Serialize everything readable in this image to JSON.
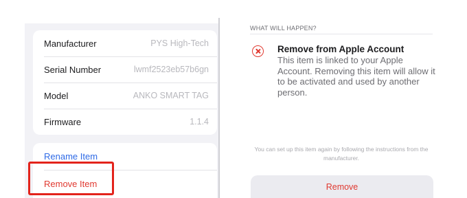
{
  "device_info": {
    "rows": [
      {
        "label": "Manufacturer",
        "value": "PYS High-Tech"
      },
      {
        "label": "Serial Number",
        "value": "lwmf2523eb57b6gn"
      },
      {
        "label": "Model",
        "value": "ANKO SMART TAG"
      },
      {
        "label": "Firmware",
        "value": "1.1.4"
      }
    ]
  },
  "actions": {
    "rename_label": "Rename Item",
    "remove_label": "Remove Item"
  },
  "confirm": {
    "section_header": "WHAT WILL HAPPEN?",
    "title": "Remove from Apple Account",
    "description": "This item is linked to your Apple Account. Removing this item will allow it to be activated and used by another person.",
    "footer_note": "You can set up this item again by following the instructions from the manufacturer.",
    "remove_button_label": "Remove",
    "warning_icon": "x-circle-icon"
  },
  "colors": {
    "accent_blue": "#2e6ae6",
    "destructive_red": "#e0382f",
    "highlight_red": "#e3231b"
  }
}
